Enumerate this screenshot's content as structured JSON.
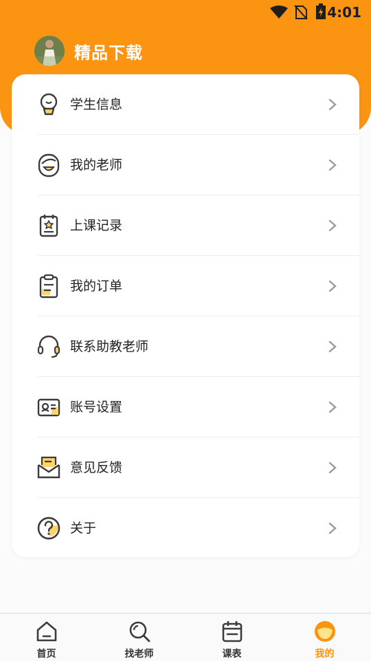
{
  "status_bar": {
    "time": "4:01"
  },
  "profile": {
    "name": "精品下载"
  },
  "menu": [
    {
      "label": "学生信息",
      "icon": "student-info-icon"
    },
    {
      "label": "我的老师",
      "icon": "teacher-icon"
    },
    {
      "label": "上课记录",
      "icon": "class-record-icon"
    },
    {
      "label": "我的订单",
      "icon": "order-icon"
    },
    {
      "label": "联系助教老师",
      "icon": "headset-icon"
    },
    {
      "label": "账号设置",
      "icon": "account-settings-icon"
    },
    {
      "label": "意见反馈",
      "icon": "feedback-icon"
    },
    {
      "label": "关于",
      "icon": "about-icon"
    }
  ],
  "tabbar": {
    "tabs": [
      {
        "label": "首页",
        "icon": "home-icon"
      },
      {
        "label": "找老师",
        "icon": "search-icon"
      },
      {
        "label": "课表",
        "icon": "calendar-icon"
      },
      {
        "label": "我的",
        "icon": "me-icon",
        "active": true
      }
    ]
  },
  "colors": {
    "accent": "#fb9411",
    "accent_light": "#fdd36b",
    "icon_stroke": "#3b3b3b"
  }
}
